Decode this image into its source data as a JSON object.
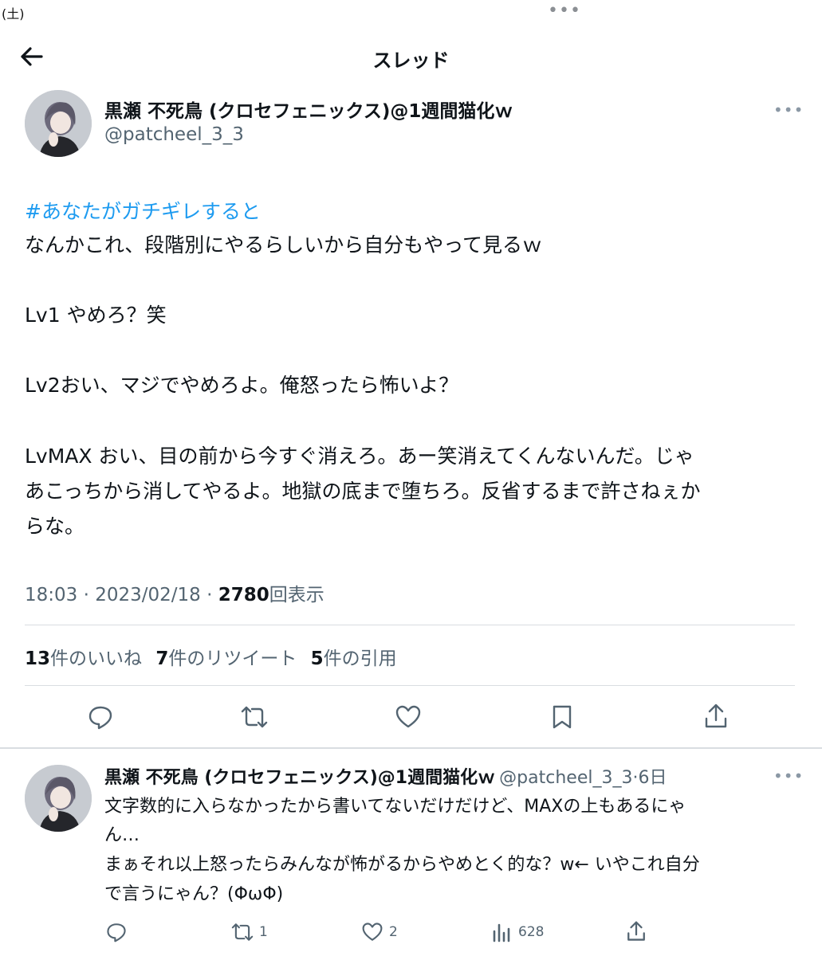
{
  "status_bar": {
    "date": "(土)",
    "menu": "•••"
  },
  "header": {
    "title": "スレッド"
  },
  "main_tweet": {
    "author_name": "黒瀬 不死鳥 (クロセフェニックス)@1週間猫化ｗ",
    "handle": "@patcheel_3_3",
    "hashtag": "#あなたがガチギレすると",
    "lines": [
      "なんかこれ、段階別にやるらしいから自分もやって見るｗ",
      "Lv1 やめろ？笑",
      "Lv2おい、マジでやめろよ。俺怒ったら怖いよ？",
      "LvMAX おい、目の前から今すぐ消えろ。あー笑消えてくんないんだ。じゃ",
      "あこっちから消してやるよ。地獄の底まで堕ちろ。反省するまで許さねぇか",
      "らな。"
    ],
    "time": "18:03 · 2023/02/18 · ",
    "views_count": "2780",
    "views_label": "回表示",
    "likes_count": "13",
    "likes_label": "件のいいね",
    "retweets_count": "7",
    "retweets_label": "件のリツイート",
    "quotes_count": "5",
    "quotes_label": "件の引用"
  },
  "reply": {
    "author_name": "黒瀬 不死鳥 (クロセフェニックス)@1週間猫化ｗ",
    "handle_time": "@patcheel_3_3·6日",
    "lines": [
      "文字数的に入らなかったから書いてないだけだけど、MAXの上もあるにゃ",
      "ん…",
      "まぁそれ以上怒ったらみんなが怖がるからやめとく的な？w← いやこれ自分",
      "で言うにゃん？(ΦωΦ)"
    ],
    "retweet_count": "1",
    "like_count": "2",
    "view_count": "628"
  },
  "colors": {
    "link": "#1d9bf0",
    "secondary": "#536471",
    "text": "#0f1419"
  }
}
